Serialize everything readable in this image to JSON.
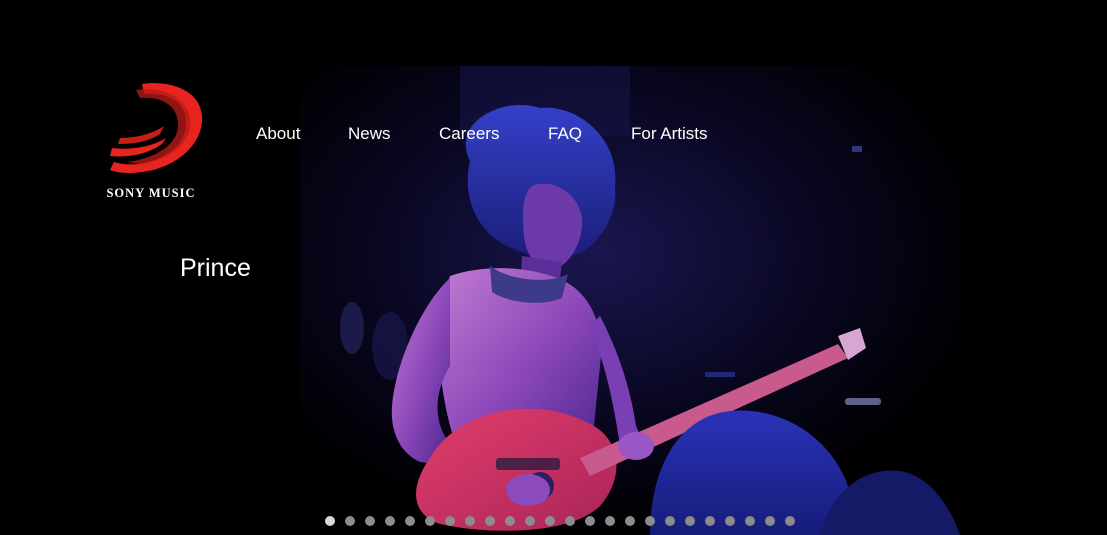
{
  "brand": {
    "logo_text": "SONY MUSIC",
    "logo_color": "#e8241f"
  },
  "nav": {
    "items": [
      {
        "label": "About"
      },
      {
        "label": "News"
      },
      {
        "label": "Careers"
      },
      {
        "label": "FAQ"
      },
      {
        "label": "For Artists"
      }
    ]
  },
  "hero": {
    "artist_name": "Prince",
    "image_icon": "concert-photo"
  },
  "carousel": {
    "slide_count": 24,
    "active_index": 0
  }
}
